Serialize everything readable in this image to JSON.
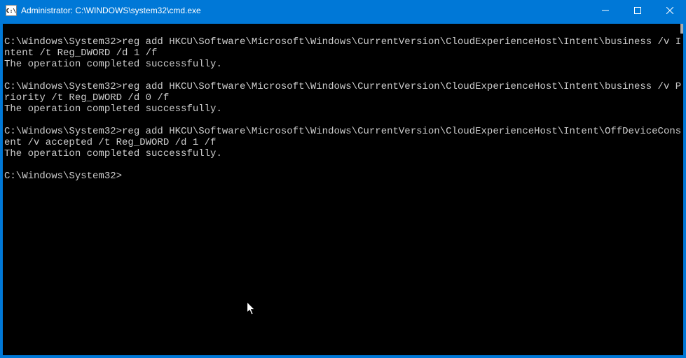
{
  "titlebar": {
    "icon_label": "C:\\",
    "title": "Administrator: C:\\WINDOWS\\system32\\cmd.exe"
  },
  "window_controls": {
    "minimize": "minimize",
    "maximize": "maximize",
    "close": "close"
  },
  "terminal": {
    "blocks": [
      {
        "prompt": "C:\\Windows\\System32>",
        "command": "reg add HKCU\\Software\\Microsoft\\Windows\\CurrentVersion\\CloudExperienceHost\\Intent\\business /v Intent /t Reg_DWORD /d 1 /f",
        "output": "The operation completed successfully."
      },
      {
        "prompt": "C:\\Windows\\System32>",
        "command": "reg add HKCU\\Software\\Microsoft\\Windows\\CurrentVersion\\CloudExperienceHost\\Intent\\business /v Priority /t Reg_DWORD /d 0 /f",
        "output": "The operation completed successfully."
      },
      {
        "prompt": "C:\\Windows\\System32>",
        "command": "reg add HKCU\\Software\\Microsoft\\Windows\\CurrentVersion\\CloudExperienceHost\\Intent\\OffDeviceConsent /v accepted /t Reg_DWORD /d 1 /f",
        "output": "The operation completed successfully."
      }
    ],
    "current_prompt": "C:\\Windows\\System32>"
  }
}
